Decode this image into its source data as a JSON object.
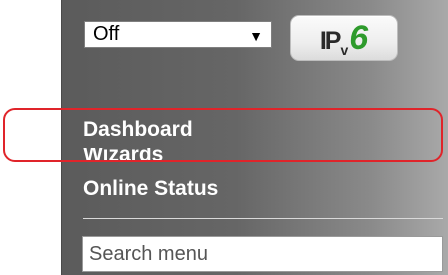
{
  "dropdown": {
    "selected": "Off",
    "arrow": "▼"
  },
  "ipv6_logo": {
    "ip": "IP",
    "v": "v",
    "six": "6",
    "accent": "#2e9b2c"
  },
  "menu": {
    "items": [
      {
        "label": "Dashboard"
      },
      {
        "label": "Wizards"
      },
      {
        "label": "Online Status"
      }
    ]
  },
  "search": {
    "placeholder": "Search menu",
    "value": ""
  },
  "colors": {
    "highlight": "#e0242a",
    "sidebar": "#666666"
  }
}
